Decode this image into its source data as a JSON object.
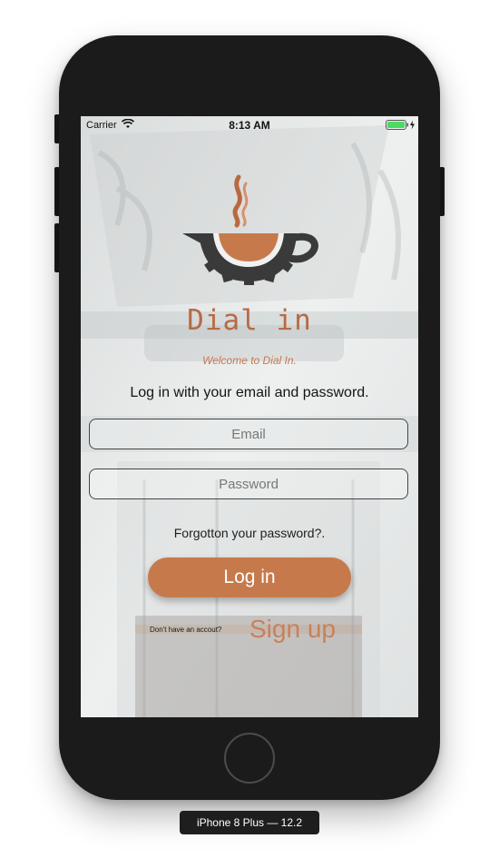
{
  "status_bar": {
    "carrier": "Carrier",
    "time": "8:13 AM",
    "wifi_icon": "wifi-icon",
    "battery_icon": "battery-charging-icon"
  },
  "branding": {
    "logo_icon": "coffee-cup-gear-logo",
    "title": "Dial in",
    "welcome": "Welcome to Dial In.",
    "accent_color": "#c67a4c"
  },
  "login": {
    "instructions": "Log in with your email and password.",
    "email_placeholder": "Email",
    "email_value": "",
    "password_placeholder": "Password",
    "password_value": "",
    "forgot_password": "Forgotton your password?.",
    "login_button": "Log in",
    "no_account_text": "Don't have an accout?",
    "signup_link": "Sign up"
  },
  "device": {
    "label": "iPhone 8 Plus — 12.2"
  }
}
